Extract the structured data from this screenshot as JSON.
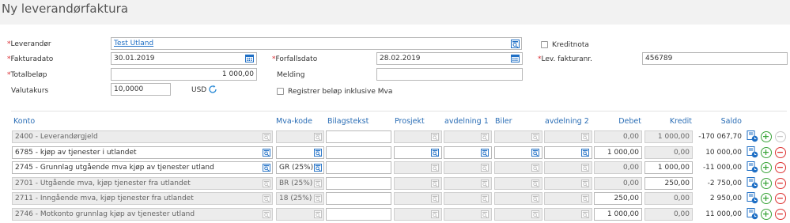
{
  "page": {
    "title": "Ny leverandørfaktura"
  },
  "form": {
    "leverandor": {
      "label": "Leverandør",
      "value": "Test Utland"
    },
    "kreditnota": {
      "label": "Kreditnota"
    },
    "fakturadato": {
      "label": "Fakturadato",
      "value": "30.01.2019"
    },
    "forfallsdato": {
      "label": "Forfallsdato",
      "value": "28.02.2019"
    },
    "lev_fakturanr": {
      "label": "Lev. fakturanr.",
      "value": "456789"
    },
    "totalbelop": {
      "label": "Totalbeløp",
      "value": "1 000,00"
    },
    "melding": {
      "label": "Melding",
      "value": ""
    },
    "valutakurs": {
      "label": "Valutakurs",
      "value": "10,0000",
      "currency": "USD"
    },
    "registrer_inkl_mva": {
      "label": "Registrer beløp inklusive Mva"
    }
  },
  "table": {
    "headers": {
      "konto": "Konto",
      "mva": "Mva-kode",
      "bilagstekst": "Bilagstekst",
      "prosjekt": "Prosjekt",
      "avd1": "avdelning 1",
      "biler": "Biler",
      "avd2": "avdelning 2",
      "debet": "Debet",
      "kredit": "Kredit",
      "saldo": "Saldo"
    },
    "rows": [
      {
        "konto": "2400 - Leverandørgjeld",
        "mva": "",
        "debet": "0,00",
        "kredit": "1 000,00",
        "saldo": "-170 067,70"
      },
      {
        "konto": "6785 - kjøp av tjenester i utlandet",
        "mva": "",
        "debet": "1 000,00",
        "kredit": "0,00",
        "saldo": "10 000,00"
      },
      {
        "konto": "2745 - Grunnlag utgående mva kjøp av tjenester utland",
        "mva": "GR (25%)",
        "debet": "0,00",
        "kredit": "1 000,00",
        "saldo": "-11 000,00"
      },
      {
        "konto": "2701 - Utgående mva, kjøp tjenester fra utlandet",
        "mva": "BR (25%)",
        "debet": "0,00",
        "kredit": "250,00",
        "saldo": "-2 750,00"
      },
      {
        "konto": "2711 - Inngående mva, kjøp tjenester fra utlandet",
        "mva": "18 (25%)",
        "debet": "250,00",
        "kredit": "0,00",
        "saldo": "2 950,00"
      },
      {
        "konto": "2746 - Motkonto grunnlag kjøp av tjenester utland",
        "mva": "",
        "debet": "1 000,00",
        "kredit": "0,00",
        "saldo": "11 000,00"
      }
    ]
  },
  "icons": {
    "lookup": "lookup-icon",
    "calendar": "calendar-icon",
    "refresh": "refresh-icon",
    "add": "plus-circle-icon",
    "remove": "minus-circle-icon",
    "document": "document-icon"
  },
  "colors": {
    "accent": "#1f6fc5",
    "required": "#d9282e",
    "add": "#3aa43a",
    "remove": "#dd3333"
  }
}
